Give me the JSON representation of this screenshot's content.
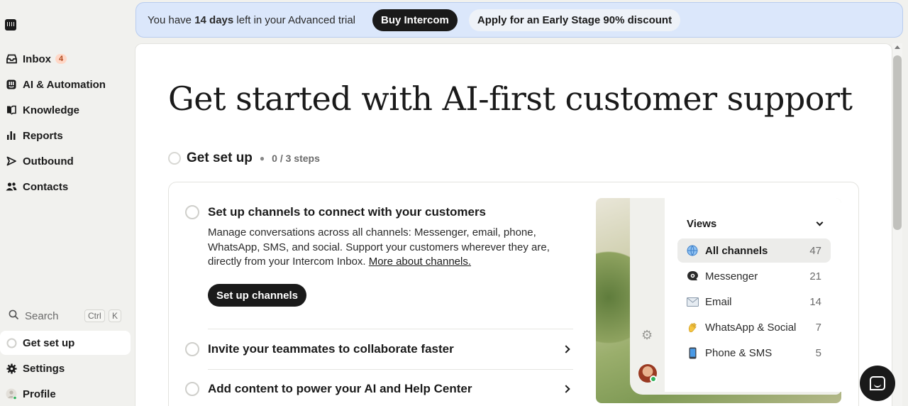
{
  "sidebar": {
    "nav": [
      {
        "label": "Inbox",
        "badge": "4",
        "icon": "inbox-icon"
      },
      {
        "label": "AI & Automation",
        "icon": "ai-icon"
      },
      {
        "label": "Knowledge",
        "icon": "book-icon"
      },
      {
        "label": "Reports",
        "icon": "bar-chart-icon"
      },
      {
        "label": "Outbound",
        "icon": "send-icon"
      },
      {
        "label": "Contacts",
        "icon": "people-icon"
      }
    ],
    "search": {
      "label": "Search",
      "shortcut_ctrl": "Ctrl",
      "shortcut_key": "K"
    },
    "bottom": [
      {
        "label": "Get set up",
        "icon": "progress-circle-icon"
      },
      {
        "label": "Settings",
        "icon": "gear-icon"
      },
      {
        "label": "Profile",
        "icon": "avatar-icon"
      }
    ]
  },
  "banner": {
    "text_prefix": "You have ",
    "days": "14 days",
    "text_suffix": " left in your Advanced trial",
    "buy_label": "Buy Intercom",
    "discount_label": "Apply for an Early Stage 90% discount"
  },
  "main": {
    "title": "Get started with AI-first customer support",
    "setup": {
      "title": "Get set up",
      "steps": "0 / 3 steps"
    },
    "steps": [
      {
        "title": "Set up channels to connect with your customers",
        "description": "Manage conversations across all channels: Messenger, email, phone, WhatsApp, SMS, and social. Support your customers wherever they are, directly from your Intercom Inbox. ",
        "link": "More about channels.",
        "button": "Set up channels"
      },
      {
        "title": "Invite your teammates to collaborate faster"
      },
      {
        "title": "Add content to power your AI and Help Center"
      }
    ],
    "preview": {
      "views_label": "Views",
      "rows": [
        {
          "label": "All channels",
          "count": "47",
          "icon": "globe-icon"
        },
        {
          "label": "Messenger",
          "count": "21",
          "icon": "messenger-icon"
        },
        {
          "label": "Email",
          "count": "14",
          "icon": "email-icon"
        },
        {
          "label": "WhatsApp & Social",
          "count": "7",
          "icon": "wave-icon"
        },
        {
          "label": "Phone & SMS",
          "count": "5",
          "icon": "phone-icon"
        }
      ]
    }
  }
}
